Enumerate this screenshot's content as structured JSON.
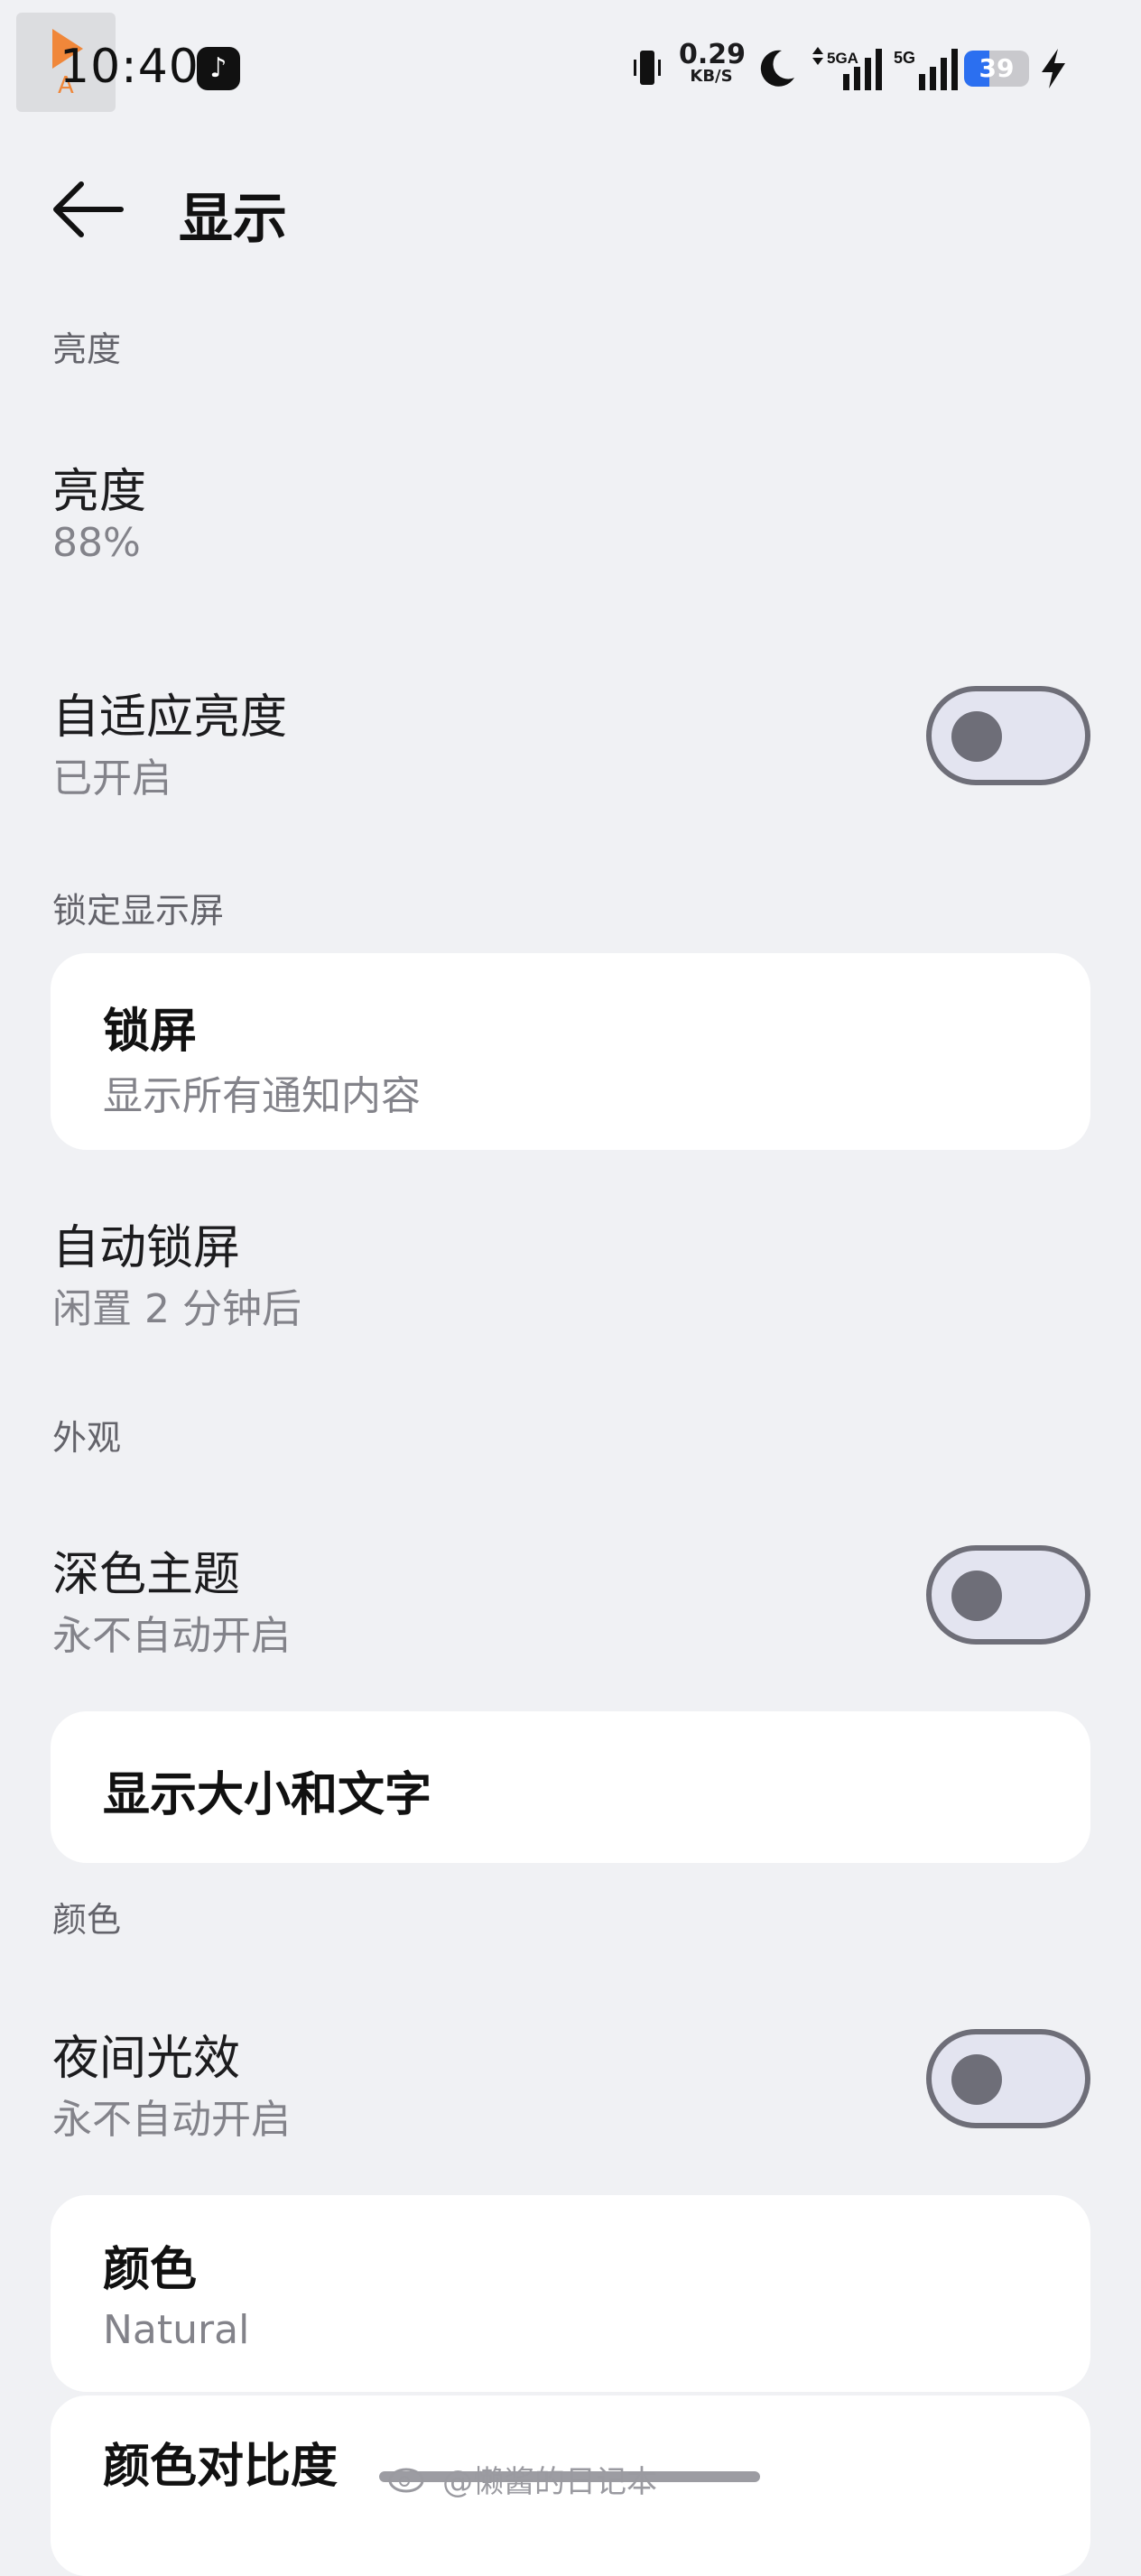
{
  "status_bar": {
    "time": "10:40",
    "pip_label": "A",
    "net_speed_value": "0.29",
    "net_speed_unit": "KB/S",
    "sig1_label": "5GA",
    "sig2_label": "5G",
    "battery_level": "39",
    "icons": [
      "video-pip-icon",
      "tiktok-icon",
      "vibrate-icon",
      "moon-icon",
      "signal-icon",
      "signal-icon",
      "battery-icon",
      "charging-icon"
    ]
  },
  "header": {
    "title": "显示",
    "back_icon": "arrow-left-icon"
  },
  "sections": {
    "brightness_header": "亮度",
    "lock_header": "锁定显示屏",
    "appearance_header": "外观",
    "color_header": "颜色"
  },
  "items": {
    "brightness": {
      "title": "亮度",
      "value": "88%"
    },
    "adaptive_brightness": {
      "title": "自适应亮度",
      "value": "已开启",
      "toggle_on": false
    },
    "lock_screen": {
      "title": "锁屏",
      "value": "显示所有通知内容"
    },
    "auto_lock": {
      "title": "自动锁屏",
      "value": "闲置 2 分钟后"
    },
    "dark_theme": {
      "title": "深色主题",
      "value": "永不自动开启",
      "toggle_on": false
    },
    "display_size": {
      "title": "显示大小和文字"
    },
    "night_light": {
      "title": "夜间光效",
      "value": "永不自动开启",
      "toggle_on": false
    },
    "colors": {
      "title": "颜色",
      "value": "Natural"
    },
    "color_contrast": {
      "title": "颜色对比度"
    }
  },
  "watermark": "@懒酱的日记本",
  "colors": {
    "background": "#f0f1f4",
    "card": "#ffffff",
    "toggle_track": "#e3e4f0",
    "toggle_border": "#6e6e78",
    "battery_fill": "#2b6ff0"
  }
}
